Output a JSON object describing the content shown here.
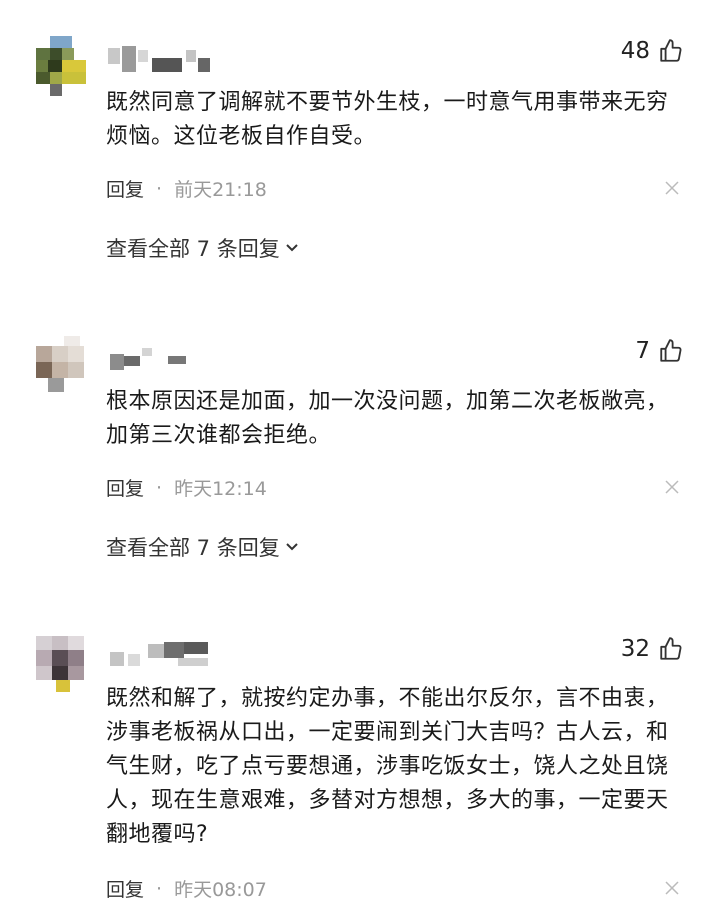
{
  "comments": [
    {
      "likes": "48",
      "text": "既然同意了调解就不要节外生枝，一时意气用事带来无穷烦恼。这位老板自作自受。",
      "reply_label": "回复",
      "dot": "·",
      "time": "前天21:18",
      "view_all": "查看全部 7 条回复"
    },
    {
      "likes": "7",
      "text": "根本原因还是加面，加一次没问题，加第二次老板敞亮，加第三次谁都会拒绝。",
      "reply_label": "回复",
      "dot": "·",
      "time": "昨天12:14",
      "view_all": "查看全部 7 条回复"
    },
    {
      "likes": "32",
      "text": "既然和解了，就按约定办事，不能出尔反尔，言不由衷，涉事老板祸从口出，一定要闹到关门大吉吗？古人云，和气生财，吃了点亏要想通，涉事吃饭女士，饶人之处且饶人，现在生意艰难，多替对方想想，多大的事，一定要天翻地覆吗?",
      "reply_label": "回复",
      "dot": "·",
      "time": "昨天08:07"
    }
  ],
  "icons": {
    "like": "thumbs-up-icon",
    "close": "close-icon",
    "expand": "chevron-down-icon"
  },
  "colors": {
    "text": "#1a1a1a",
    "muted": "#999999",
    "icon": "#333333"
  }
}
